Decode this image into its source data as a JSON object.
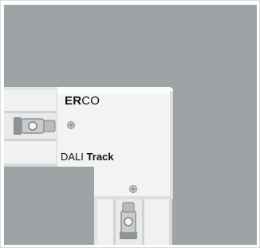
{
  "image": {
    "subject": "track-corner-connector",
    "colors": {
      "background": "#9ea3a6",
      "housing": "#f2f2f2",
      "housing_shade": "#dcdedf",
      "frame": "#d9dadb"
    }
  },
  "brand": {
    "bold_part": "ER",
    "regular_part": "CO"
  },
  "product": {
    "word1": "DALI",
    "word2": "Track"
  }
}
